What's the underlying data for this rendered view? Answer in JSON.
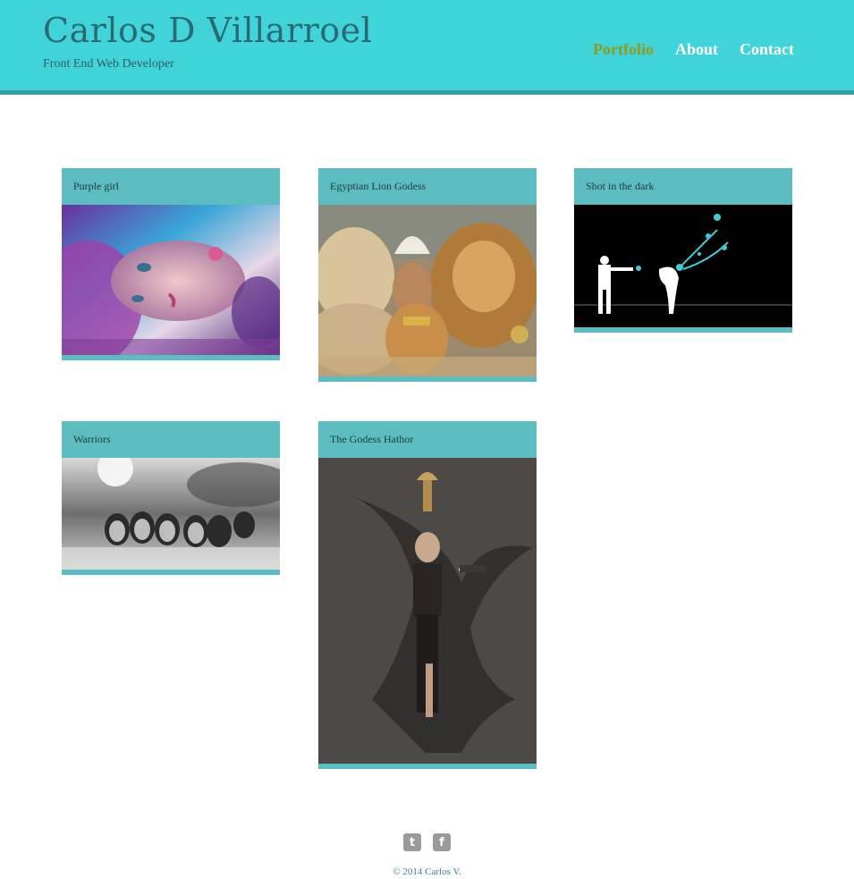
{
  "header": {
    "title": "Carlos D Villarroel",
    "subtitle": "Front End Web Developer",
    "nav": [
      {
        "label": "Portfolio",
        "active": true
      },
      {
        "label": "About",
        "active": false
      },
      {
        "label": "Contact",
        "active": false
      }
    ]
  },
  "portfolio": {
    "items": [
      {
        "title": "Purple girl"
      },
      {
        "title": "Egyptian Lion Godess"
      },
      {
        "title": "Shot in the dark"
      },
      {
        "title": "Warriors"
      },
      {
        "title": "The Godess Hathor"
      }
    ]
  },
  "footer": {
    "social": [
      {
        "icon": "twitter-icon",
        "glyph": "t"
      },
      {
        "icon": "facebook-icon",
        "glyph": "f"
      }
    ],
    "copyright": "© 2014 Carlos V."
  },
  "colors": {
    "header_bg": "#40d4d9",
    "header_border": "#3a9ea3",
    "card_bg": "#5dbcbf",
    "nav_active": "#8f9a1f",
    "title_text": "#2a6b73"
  }
}
